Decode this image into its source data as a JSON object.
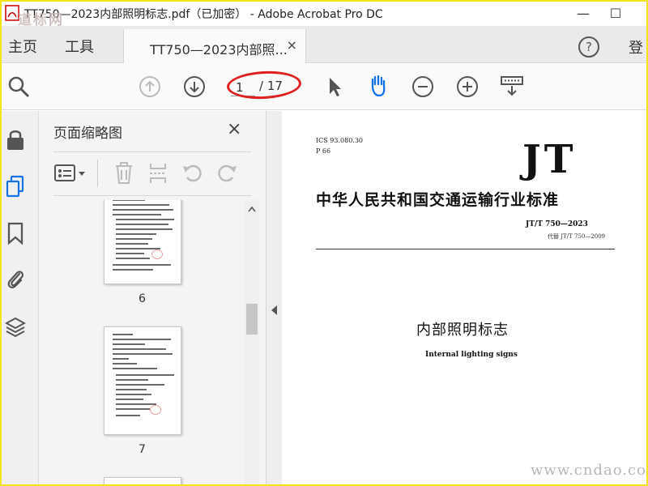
{
  "window": {
    "title": "TT750—2023内部照明标志.pdf（已加密） - Adobe Acrobat Pro DC",
    "watermark_top_left": "道标网",
    "minimize": "—",
    "maximize": "☐"
  },
  "menu": {
    "home": "主页",
    "tools": "工具",
    "signin": "登"
  },
  "tab": {
    "label": "TT750—2023内部照...",
    "close": "×"
  },
  "toolbar": {
    "current_page": "1",
    "total_pages": "/ 17"
  },
  "thumbnails_panel": {
    "title": "页面缩略图",
    "close": "×",
    "pages": [
      {
        "number": "6"
      },
      {
        "number": "7"
      }
    ]
  },
  "document": {
    "ics": "ICS 93.080.30",
    "p_code": "P 66",
    "logo": "JT",
    "standard_title": "中华人民共和国交通运输行业标准",
    "standard_code": "JT/T 750—2023",
    "replaces": "代替 JT/T 750—2009",
    "title_cn": "内部照明标志",
    "title_en": "Internal lighting signs"
  },
  "watermark_bottom_right": "www.cndao.com",
  "colors": {
    "frame": "#f2e51a",
    "hand_tool_active": "#1473e6",
    "annotation_circle": "#e02020"
  }
}
